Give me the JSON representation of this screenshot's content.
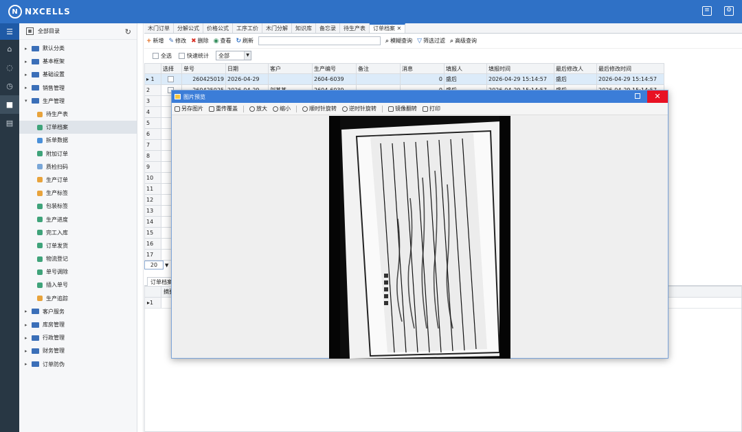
{
  "app": {
    "logo_text": "NXCELLS"
  },
  "top_icons": [
    "document-icon",
    "user-settings-icon"
  ],
  "left_icons": [
    "menu-icon",
    "home-icon",
    "chat-icon",
    "clock-icon",
    "cube-icon",
    "printer-icon"
  ],
  "tree": {
    "root": "全部目录",
    "items": [
      {
        "label": "默认分类",
        "level": 1
      },
      {
        "label": "基本框架",
        "level": 1
      },
      {
        "label": "基础设置",
        "level": 1
      },
      {
        "label": "销售管理",
        "level": 1
      },
      {
        "label": "生产管理",
        "level": 1,
        "expanded": true
      },
      {
        "label": "待生产表",
        "level": 2
      },
      {
        "label": "订单档案",
        "level": 2,
        "selected": true
      },
      {
        "label": "拆单数据",
        "level": 2
      },
      {
        "label": "附加订单",
        "level": 2
      },
      {
        "label": "质检扫码",
        "level": 2
      },
      {
        "label": "生产订单",
        "level": 2
      },
      {
        "label": "生产标签",
        "level": 2
      },
      {
        "label": "包装标签",
        "level": 2
      },
      {
        "label": "生产进度",
        "level": 2
      },
      {
        "label": "完工入库",
        "level": 2
      },
      {
        "label": "订单发货",
        "level": 2
      },
      {
        "label": "物流登记",
        "level": 2
      },
      {
        "label": "单号调除",
        "level": 2
      },
      {
        "label": "插入单号",
        "level": 2
      },
      {
        "label": "生产追踪",
        "level": 2
      },
      {
        "label": "客户服务",
        "level": 1
      },
      {
        "label": "库房管理",
        "level": 1
      },
      {
        "label": "行政管理",
        "level": 1
      },
      {
        "label": "财务管理",
        "level": 1
      },
      {
        "label": "订单防伪",
        "level": 1
      }
    ]
  },
  "tabs": [
    "木门订单",
    "分解公式",
    "价格公式",
    "工序工价",
    "木门分解",
    "知识库",
    "备忘录",
    "待生产表",
    "订单档案"
  ],
  "toolbar": {
    "new": "新增",
    "edit": "修改",
    "delete": "删除",
    "view": "查看",
    "refresh": "刷新",
    "fuzzy": "模糊查询",
    "filter": "筛选过滤",
    "advanced": "高级查询"
  },
  "filters": {
    "select_all": "全选",
    "quick_stats": "快速统计",
    "range": "全部"
  },
  "grid": {
    "columns": [
      "选择",
      "单号",
      "日期",
      "客户",
      "生产编号",
      "备注",
      "消息",
      "填报人",
      "填报时间",
      "最后修改人",
      "最后修改时间"
    ],
    "rows": [
      [
        "1",
        "260425019",
        "2026-04-29",
        "",
        "2604-6039",
        "",
        "0",
        "盛后",
        "2026-04-29 15:14:57",
        "盛后",
        "2026-04-29 15:14:57"
      ],
      [
        "2",
        "260425025",
        "2026-04-29",
        "刘某某",
        "2604-6039",
        "",
        "0",
        "盛后",
        "2026-04-29 15:14:57",
        "盛后",
        "2026-04-29 15:14:57"
      ]
    ],
    "row_numbers": [
      "3",
      "4",
      "5",
      "6",
      "7",
      "8",
      "9",
      "10",
      "11",
      "12",
      "13",
      "14",
      "15",
      "16",
      "17"
    ]
  },
  "pager": {
    "size": "20"
  },
  "bottom_tab": "订单档案",
  "bottom_grid": {
    "col1": "摘要",
    "row": "1"
  },
  "dialog": {
    "title": "图片预览",
    "tools": [
      "另存图片",
      "重传覆盖",
      "放大",
      "缩小",
      "顺时针旋转",
      "逆时针旋转",
      "镜像翻转",
      "打印"
    ],
    "close": "✕"
  }
}
